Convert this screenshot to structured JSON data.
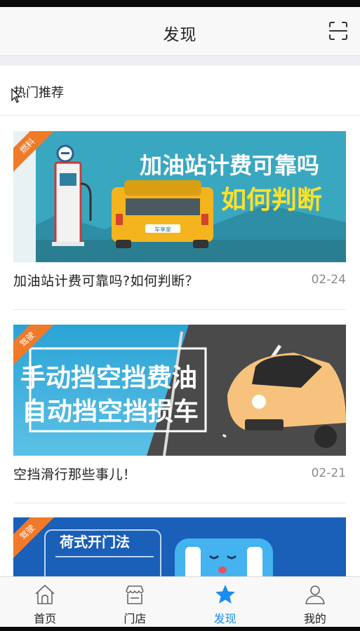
{
  "header": {
    "title": "发现",
    "scan_icon": "scan-icon"
  },
  "section": {
    "title": "热门推荐"
  },
  "articles": [
    {
      "tag": "燃料",
      "title": "加油站计费可靠吗?如何判断？",
      "date": "02-24",
      "banner_line1": "加油站计费可靠吗",
      "banner_line2": "如何判断",
      "plate": "车享家",
      "colors": {
        "sky": "#3aa7c0",
        "car": "#f4b41e",
        "accent": "#ffe12a"
      }
    },
    {
      "tag": "驾驶",
      "title": "空挡滑行那些事儿！",
      "date": "02-21",
      "banner_line1": "手动挡空挡费油",
      "banner_line2": "自动挡空挡损车",
      "colors": {
        "sky": "#2d9fd0",
        "car": "#f6c27e",
        "road": "#4a4a4a"
      }
    },
    {
      "tag": "驾驶",
      "banner_line1": "荷式开门法",
      "colors": {
        "sky": "#1a5fb8",
        "char": "#44b3f0"
      }
    }
  ],
  "tabbar": {
    "tabs": [
      {
        "label": "首页",
        "icon": "home-icon",
        "active": false
      },
      {
        "label": "门店",
        "icon": "store-icon",
        "active": false
      },
      {
        "label": "发现",
        "icon": "star-icon",
        "active": true
      },
      {
        "label": "我的",
        "icon": "profile-icon",
        "active": false
      }
    ],
    "active_color": "#1a8cf0"
  }
}
